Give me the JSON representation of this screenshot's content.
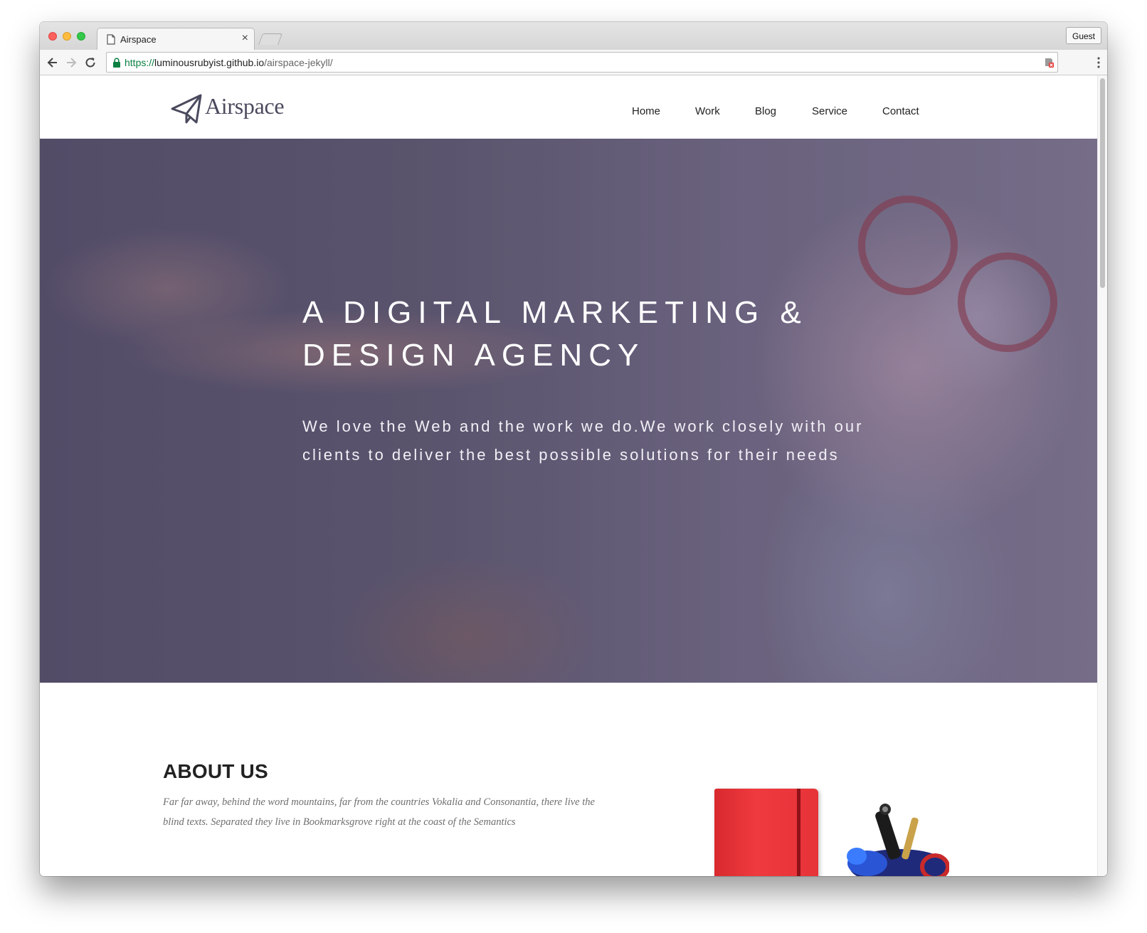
{
  "browser": {
    "tab_title": "Airspace",
    "tab_close": "×",
    "profile_button": "Guest",
    "url": {
      "scheme": "https://",
      "host": "luminousrubyist.github.io",
      "path": "/airspace-jekyll/"
    }
  },
  "site": {
    "logo_text": "Airspace",
    "nav": [
      "Home",
      "Work",
      "Blog",
      "Service",
      "Contact"
    ]
  },
  "hero": {
    "title_line1": "A DIGITAL MARKETING &",
    "title_line2": "DESIGN AGENCY",
    "subtitle_line1": "We love the Web and the work we do.We work closely with our",
    "subtitle_line2": "clients to deliver the best possible solutions for their needs"
  },
  "about": {
    "title": "ABOUT US",
    "text_line1": "Far far away, behind the word mountains, far from the countries Vokalia and Consonantia, there live the",
    "text_line2": "blind texts. Separated they live in Bookmarksgrove right at the coast of the Semantics"
  },
  "colors": {
    "accent_green": "#0b8043",
    "hero_overlay": "#5d5870",
    "notebook_red": "#e63338"
  },
  "icons": [
    "page-icon",
    "back-arrow-icon",
    "forward-arrow-icon",
    "reload-icon",
    "lock-icon",
    "extension-icon",
    "menu-dots-icon",
    "paper-plane-icon"
  ]
}
